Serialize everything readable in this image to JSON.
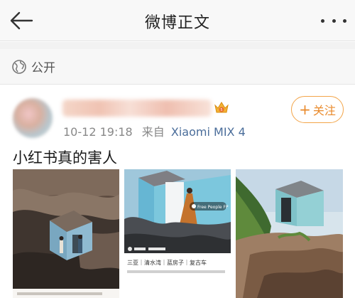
{
  "nav": {
    "title": "微博正文"
  },
  "visibility": {
    "label": "公开"
  },
  "post": {
    "timestamp": "10-12 19:18",
    "source_prefix": "来自",
    "device": "Xiaomi MIX 4",
    "follow_label": "关注",
    "text": "小红书真的害人"
  },
  "photos": [
    {
      "tag": ""
    },
    {
      "tag": "Free People FP",
      "bottom_text": "三亚｜清水湾｜蓝房子｜复古车"
    },
    {
      "tag": ""
    }
  ],
  "colors": {
    "accent_orange": "#e98a2b",
    "link_blue": "#4a6d9a"
  }
}
